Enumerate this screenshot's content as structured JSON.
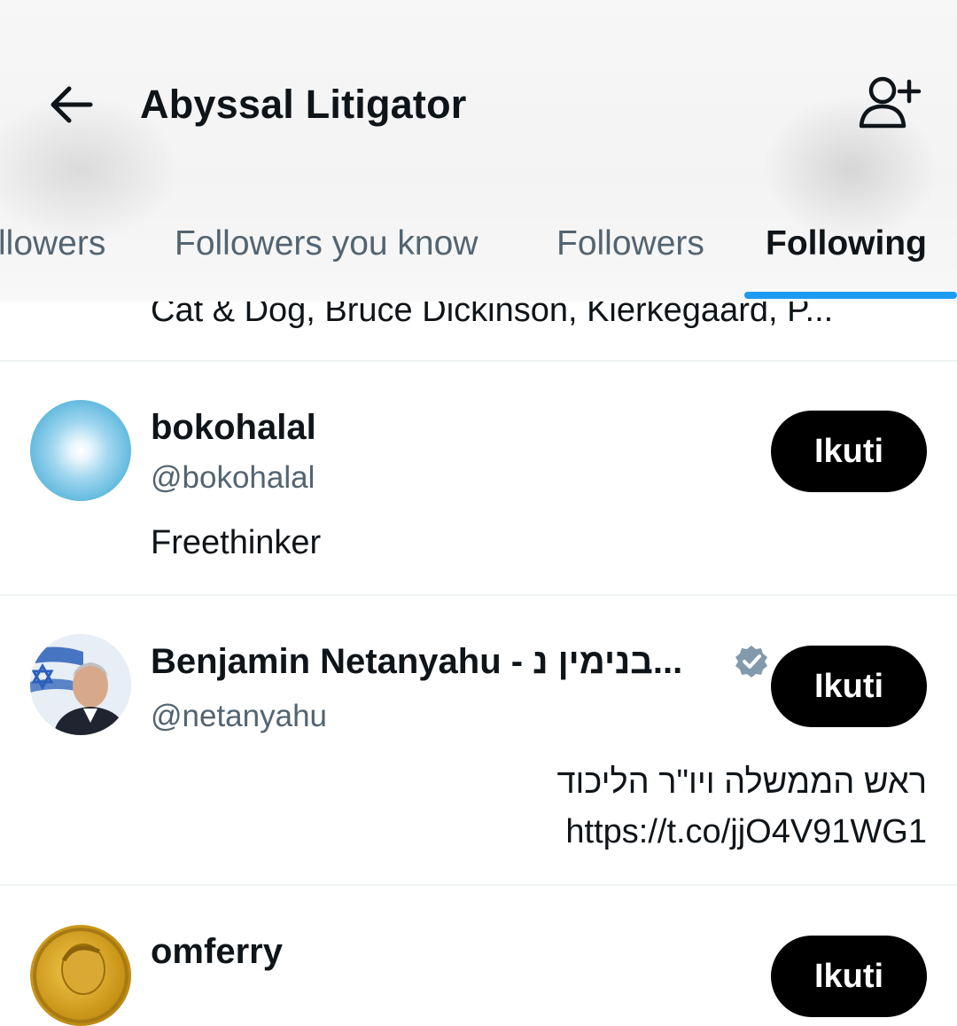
{
  "header": {
    "title": "Abyssal Litigator",
    "back_icon": "arrow-left-icon",
    "add_icon": "person-add-icon"
  },
  "tabs": [
    {
      "label": "llowers",
      "active": false
    },
    {
      "label": "Followers you know",
      "active": false
    },
    {
      "label": "Followers",
      "active": false
    },
    {
      "label": "Following",
      "active": true
    }
  ],
  "accent_color": "#1d9bf0",
  "partial_bio": "Cat & Dog, Bruce Dickinson, Kierkegaard, P...",
  "users": [
    {
      "name": "bokohalal",
      "handle": "@bokohalal",
      "bio_lines": [
        "Freethinker"
      ],
      "follow_label": "Ikuti",
      "verified": false
    },
    {
      "name": "Benjamin Netanyahu - בנימין נ...",
      "handle": "@netanyahu",
      "bio_lines": [
        "ראש הממשלה ויו\"ר הליכוד",
        "https://t.co/jjO4V91WG1"
      ],
      "follow_label": "Ikuti",
      "verified": true
    },
    {
      "name": "omferry",
      "handle": "",
      "bio_lines": [],
      "follow_label": "Ikuti",
      "verified": false
    }
  ]
}
